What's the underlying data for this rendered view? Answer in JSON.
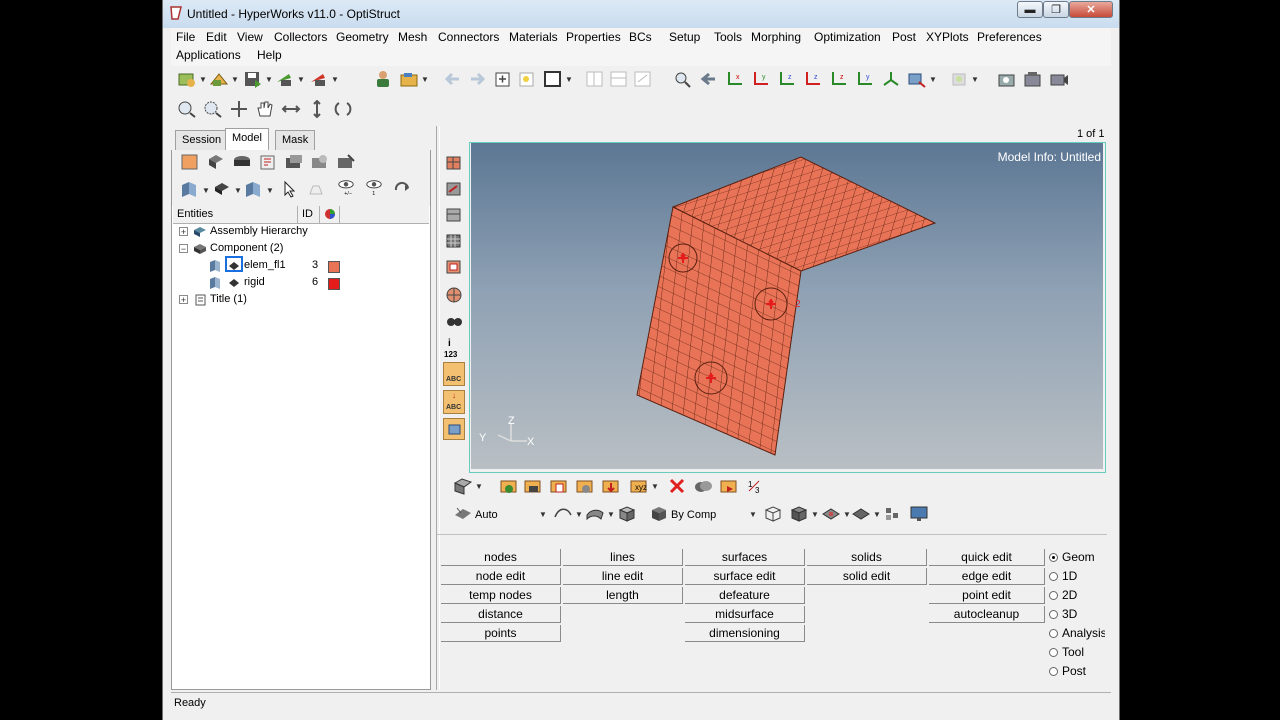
{
  "window": {
    "title": "Untitled - HyperWorks v11.0 - OptiStruct",
    "buttons": {
      "min": "▬",
      "max": "❐",
      "close": "✕"
    }
  },
  "menu": [
    "File",
    "Edit",
    "View",
    "Collectors",
    "Geometry",
    "Mesh",
    "Connectors",
    "Materials",
    "Properties",
    "BCs",
    "Setup",
    "Tools",
    "Morphing",
    "Optimization",
    "Post",
    "XYPlots",
    "Preferences",
    "Applications",
    "Help"
  ],
  "tabs": [
    "Session",
    "Model",
    "Mask"
  ],
  "tree": {
    "headers": {
      "entities": "Entities",
      "id": "ID"
    },
    "rows": [
      {
        "label": "Assembly Hierarchy"
      },
      {
        "label": "Component (2)"
      },
      {
        "label": "elem_fl1",
        "id": "3",
        "color": "#e97356"
      },
      {
        "label": "rigid",
        "id": "6",
        "color": "#e51c1c"
      },
      {
        "label": "Title (1)"
      }
    ]
  },
  "viewport": {
    "page_indicator": "1 of 1",
    "model_info": "Model Info: Untitled",
    "axes": {
      "z": "Z",
      "y": "Y",
      "x": "X"
    },
    "node_label": "2",
    "side_labels": {
      "info": "i",
      "num": "123",
      "abc1": "ABC",
      "abc2": "ABC"
    }
  },
  "toolbar3": {
    "auto_label": "Auto",
    "bycomp_label": "By Comp"
  },
  "panel": {
    "columns": [
      [
        "nodes",
        "node edit",
        "temp nodes",
        "distance",
        "points"
      ],
      [
        "lines",
        "line edit",
        "length"
      ],
      [
        "surfaces",
        "surface edit",
        "defeature",
        "midsurface",
        "dimensioning"
      ],
      [
        "solids",
        "solid edit"
      ],
      [
        "quick edit",
        "edge edit",
        "point edit",
        "autocleanup"
      ]
    ],
    "radios": [
      "Geom",
      "1D",
      "2D",
      "3D",
      "Analysis",
      "Tool",
      "Post"
    ],
    "selected_radio": "Geom"
  },
  "status": "Ready",
  "colors": {
    "mesh": "#e97356",
    "rigid": "#e51c1c",
    "viewport_top": "#5c7794",
    "viewport_bottom": "#b9bfc4"
  }
}
